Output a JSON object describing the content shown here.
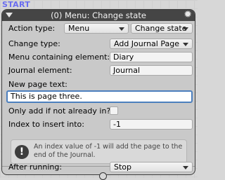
{
  "start_label": "START",
  "node": {
    "title": "(0) Menu: Change state",
    "action_type": {
      "label": "Action type:",
      "category": "Menu",
      "action": "Change state"
    },
    "change_type": {
      "label": "Change type:",
      "value": "Add Journal Page"
    },
    "menu_element": {
      "label": "Menu containing element:",
      "value": "Diary"
    },
    "journal_element": {
      "label": "Journal element:",
      "value": "Journal"
    },
    "new_page_text": {
      "label": "New page text:",
      "value": "This is page three."
    },
    "only_add": {
      "label": "Only add if not already in?",
      "checked": false
    },
    "index_insert": {
      "label": "Index to insert into:",
      "value": "-1"
    },
    "help": {
      "icon": "exclamation-icon",
      "text": "An index value of -1 will add the page to the end of the Journal."
    },
    "after_running": {
      "label": "After running:",
      "value": "Stop"
    }
  }
}
